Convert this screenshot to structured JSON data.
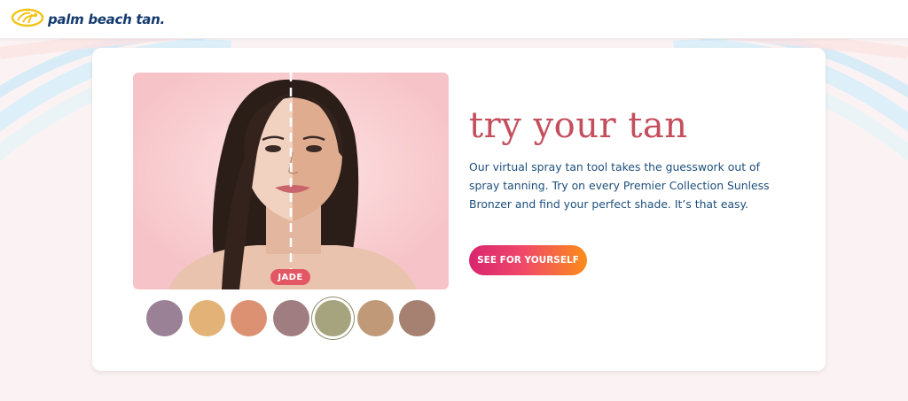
{
  "brand": {
    "name": "palm beach tan."
  },
  "hero": {
    "headline": "try your tan",
    "description": "Our virtual spray tan tool takes the guesswork out of spray tanning. Try on every Premier Collection Sunless Bronzer and find your perfect shade. It’s that easy.",
    "cta_label": "SEE FOR YOURSELF"
  },
  "preview": {
    "selected_shade": "JADE"
  },
  "swatches": [
    {
      "color": "#9a8196",
      "selected": false
    },
    {
      "color": "#e3b276",
      "selected": false
    },
    {
      "color": "#dc9272",
      "selected": false
    },
    {
      "color": "#a07d80",
      "selected": false
    },
    {
      "color": "#a6a47e",
      "selected": true
    },
    {
      "color": "#c09a78",
      "selected": false
    },
    {
      "color": "#a68070",
      "selected": false
    }
  ],
  "colors": {
    "headline": "#c54e5d",
    "body_text": "#1d4f7c",
    "cta_gradient_start": "#d8256e",
    "cta_gradient_end": "#fb8c19",
    "photo_background": "#f8c6ca"
  }
}
